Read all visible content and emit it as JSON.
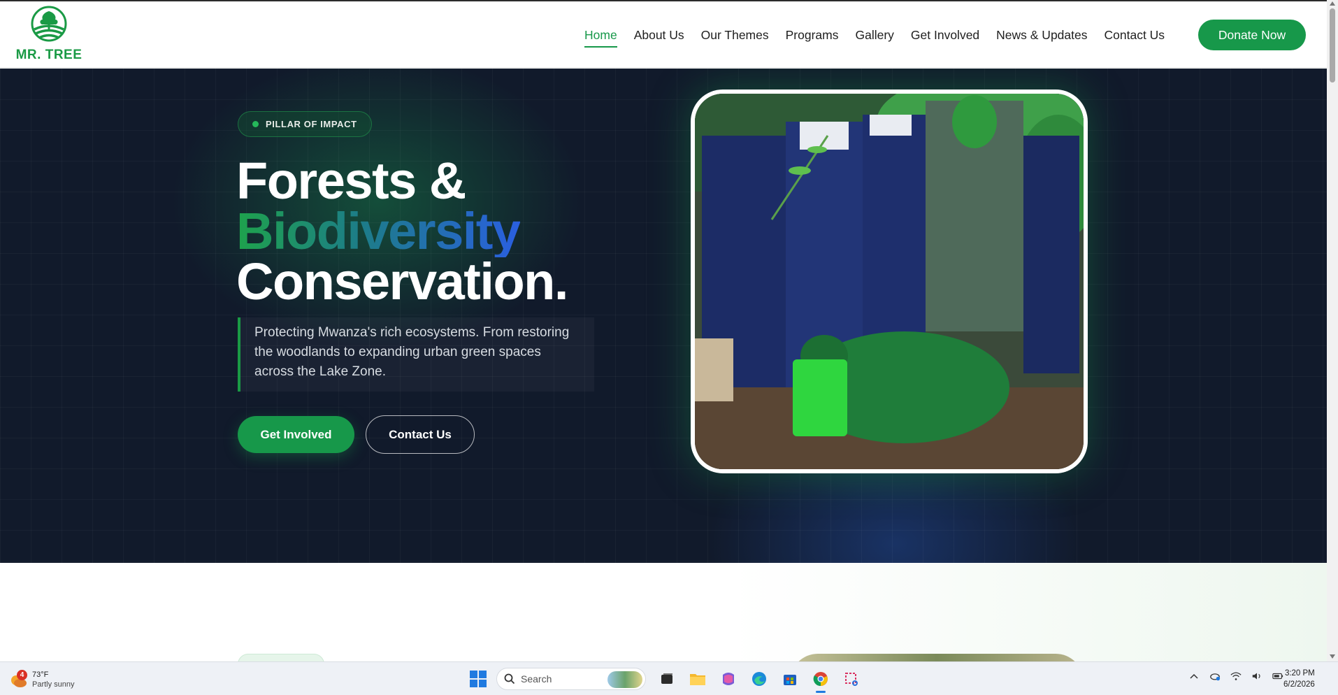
{
  "brand": {
    "name": "MR. TREE",
    "color": "#1a9a45"
  },
  "nav": {
    "items": [
      {
        "label": "Home",
        "active": true
      },
      {
        "label": "About Us",
        "active": false
      },
      {
        "label": "Our Themes",
        "active": false
      },
      {
        "label": "Programs",
        "active": false
      },
      {
        "label": "Gallery",
        "active": false
      },
      {
        "label": "Get Involved",
        "active": false
      },
      {
        "label": "News & Updates",
        "active": false
      },
      {
        "label": "Contact Us",
        "active": false
      }
    ],
    "donate_label": "Donate Now"
  },
  "hero": {
    "badge": "PILLAR OF IMPACT",
    "title_line1": "Forests &",
    "title_line2": "Biodiversity",
    "title_line3": "Conservation.",
    "description": "Protecting Mwanza's rich ecosystems. From restoring the woodlands to expanding urban green spaces across the Lake Zone.",
    "primary_button": "Get Involved",
    "secondary_button": "Contact Us",
    "image_icon": "tree-planting-photo"
  },
  "colors": {
    "accent": "#17984a",
    "hero_bg": "#111a2b",
    "gradient_start": "#1ea24c",
    "gradient_end": "#2a5fe0"
  },
  "taskbar": {
    "weather": {
      "temp": "73°F",
      "desc": "Partly sunny",
      "badge": "4"
    },
    "search_placeholder": "Search",
    "time": "3:20 PM",
    "date": "6/2/2026",
    "icons": [
      "windows-start-icon",
      "search-icon",
      "task-view-icon",
      "file-explorer-icon",
      "m365-copilot-icon",
      "edge-icon",
      "store-icon",
      "chrome-icon",
      "snipping-tool-icon"
    ],
    "tray_icons": [
      "chevron-up-icon",
      "onedrive-icon",
      "wifi-icon",
      "volume-icon",
      "battery-icon"
    ]
  }
}
